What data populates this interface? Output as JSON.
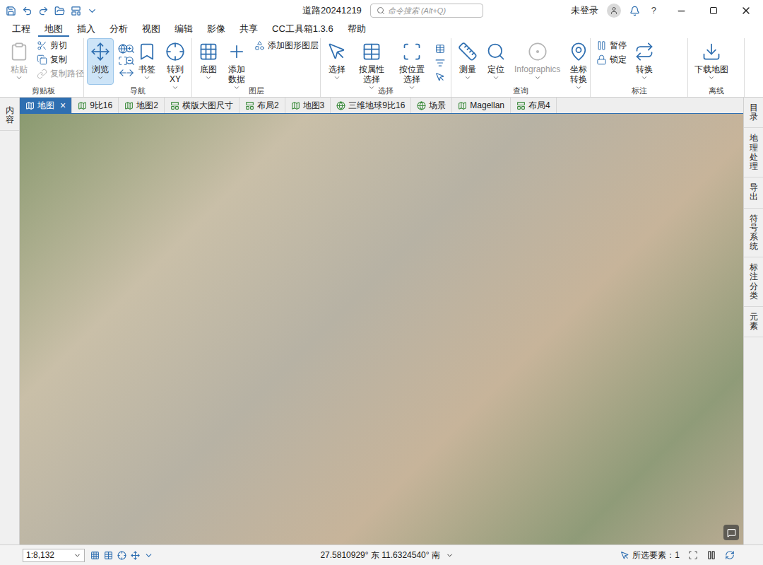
{
  "window": {
    "title": "道路20241219",
    "search_placeholder": "命令搜索 (Alt+Q)",
    "user": "未登录",
    "help": "?"
  },
  "menu_tabs": [
    {
      "label": "工程",
      "selected": false
    },
    {
      "label": "地图",
      "selected": true
    },
    {
      "label": "插入",
      "selected": false
    },
    {
      "label": "分析",
      "selected": false
    },
    {
      "label": "视图",
      "selected": false
    },
    {
      "label": "编辑",
      "selected": false
    },
    {
      "label": "影像",
      "selected": false
    },
    {
      "label": "共享",
      "selected": false
    },
    {
      "label": "CC工具箱1.3.6",
      "selected": false
    },
    {
      "label": "帮助",
      "selected": false
    }
  ],
  "ribbon_groups": [
    {
      "label": "剪贴板",
      "tools": [
        {
          "label": "粘贴",
          "kind": "large",
          "disabled": true,
          "selected": false
        },
        {
          "label": "剪切",
          "kind": "small",
          "disabled": false,
          "selected": false
        },
        {
          "label": "复制",
          "kind": "small",
          "disabled": false,
          "selected": false
        },
        {
          "label": "复制路径",
          "kind": "small",
          "disabled": true,
          "selected": false
        }
      ]
    },
    {
      "label": "导航",
      "tools": [
        {
          "label": "浏览",
          "kind": "large",
          "disabled": false,
          "selected": true
        },
        {
          "label": "书签",
          "kind": "large",
          "disabled": false,
          "selected": false
        },
        {
          "label": "转到\nXY",
          "kind": "large",
          "disabled": false,
          "selected": false
        }
      ]
    },
    {
      "label": "图层",
      "tools": [
        {
          "label": "底图",
          "kind": "large",
          "disabled": false,
          "selected": false
        },
        {
          "label": "添加数据",
          "kind": "large",
          "disabled": false,
          "selected": false
        },
        {
          "label": "添加图形图层",
          "kind": "small",
          "disabled": false,
          "selected": false
        }
      ]
    },
    {
      "label": "选择",
      "tools": [
        {
          "label": "选择",
          "kind": "large",
          "disabled": false,
          "selected": false
        },
        {
          "label": "按属性选择",
          "kind": "large",
          "disabled": false,
          "selected": false
        },
        {
          "label": "按位置选择",
          "kind": "large",
          "disabled": false,
          "selected": false
        }
      ]
    },
    {
      "label": "查询",
      "tools": [
        {
          "label": "测量",
          "kind": "large",
          "disabled": false,
          "selected": false
        },
        {
          "label": "定位",
          "kind": "large",
          "disabled": false,
          "selected": false
        },
        {
          "label": "Infographics",
          "kind": "large",
          "disabled": true,
          "selected": false
        },
        {
          "label": "坐标转换",
          "kind": "large",
          "disabled": false,
          "selected": false
        }
      ]
    },
    {
      "label": "标注",
      "tools": [
        {
          "label": "暂停",
          "kind": "small",
          "disabled": false,
          "selected": false
        },
        {
          "label": "锁定",
          "kind": "small",
          "disabled": false,
          "selected": false
        },
        {
          "label": "转换",
          "kind": "large",
          "disabled": false,
          "selected": false
        }
      ]
    },
    {
      "label": "离线",
      "tools": [
        {
          "label": "下载地图",
          "kind": "large",
          "disabled": false,
          "selected": false
        }
      ]
    }
  ],
  "view_tabs": [
    {
      "label": "地图",
      "selected": true,
      "closable": true
    },
    {
      "label": "9比16",
      "selected": false,
      "closable": false
    },
    {
      "label": "地图2",
      "selected": false,
      "closable": false
    },
    {
      "label": "横版大图尺寸",
      "selected": false,
      "closable": false
    },
    {
      "label": "布局2",
      "selected": false,
      "closable": false
    },
    {
      "label": "地图3",
      "selected": false,
      "closable": false
    },
    {
      "label": "三维地球9比16",
      "selected": false,
      "closable": false
    },
    {
      "label": "场景",
      "selected": false,
      "closable": false
    },
    {
      "label": "Magellan",
      "selected": false,
      "closable": false
    },
    {
      "label": "布局4",
      "selected": false,
      "closable": false
    }
  ],
  "close_glyph": "×",
  "left_panel": {
    "label": "内容"
  },
  "right_panels": [
    "目录",
    "地理处理",
    "导出",
    "符号系统",
    "标注分类",
    "元素"
  ],
  "status_bar": {
    "scale": "1:8,132",
    "coordinates": "27.5810929° 东 11.6324540° 南",
    "selected_features": "所选要素：1"
  }
}
